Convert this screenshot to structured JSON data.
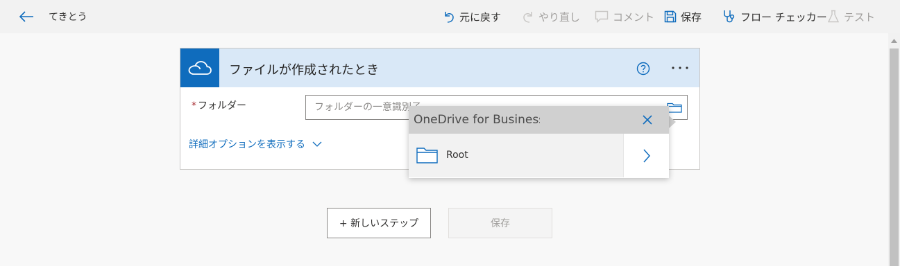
{
  "topbar": {
    "flow_name": "てきとう",
    "undo_label": "元に戻す",
    "redo_label": "やり直し",
    "comment_label": "コメント",
    "save_label": "保存",
    "flow_checker_label": "フロー チェッカー",
    "test_label": "テスト"
  },
  "trigger_card": {
    "title": "ファイルが作成されたとき",
    "folder_label": "フォルダー",
    "required_mark": "*",
    "folder_placeholder": "フォルダーの一意識別子",
    "folder_value": "",
    "advanced_options_label": "詳細オプションを表示する"
  },
  "folder_picker": {
    "title": "OneDrive for Business",
    "items": [
      {
        "label": "Root"
      }
    ]
  },
  "footer": {
    "new_step_label": "+ 新しいステップ",
    "save_label": "保存"
  },
  "colors": {
    "accent": "#0f6cbd",
    "card_header": "#d9e8f7",
    "disabled_text": "#a19f9d",
    "required": "#a4262c"
  }
}
